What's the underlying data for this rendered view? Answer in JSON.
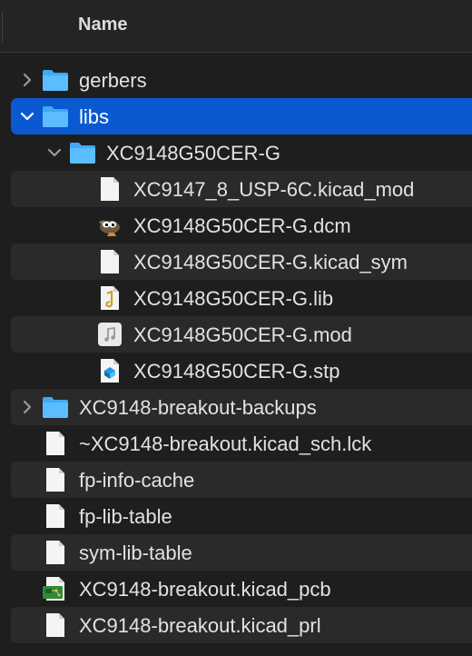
{
  "header": {
    "name_label": "Name"
  },
  "rows": [
    {
      "name": "gerbers",
      "kind": "folder",
      "chevron": "right",
      "alt": false,
      "selected": false
    },
    {
      "name": "libs",
      "kind": "folder",
      "chevron": "down",
      "alt": false,
      "selected": true
    },
    {
      "name": "XC9148G50CER-G",
      "kind": "folder",
      "chevron": "down",
      "alt": false,
      "selected": false
    },
    {
      "name": "XC9147_8_USP-6C.kicad_mod",
      "kind": "file-blank",
      "alt": true,
      "selected": false
    },
    {
      "name": "XC9148G50CER-G.dcm",
      "kind": "file-gimp",
      "alt": false,
      "selected": false
    },
    {
      "name": "XC9148G50CER-G.kicad_sym",
      "kind": "file-blank",
      "alt": true,
      "selected": false
    },
    {
      "name": "XC9148G50CER-G.lib",
      "kind": "file-lib",
      "alt": false,
      "selected": false
    },
    {
      "name": "XC9148G50CER-G.mod",
      "kind": "file-audio",
      "alt": true,
      "selected": false
    },
    {
      "name": "XC9148G50CER-G.stp",
      "kind": "file-stp",
      "alt": false,
      "selected": false
    },
    {
      "name": "XC9148-breakout-backups",
      "kind": "folder",
      "chevron": "right",
      "alt": true,
      "selected": false
    },
    {
      "name": "~XC9148-breakout.kicad_sch.lck",
      "kind": "file-blank",
      "alt": false,
      "selected": false
    },
    {
      "name": "fp-info-cache",
      "kind": "file-blank",
      "alt": true,
      "selected": false
    },
    {
      "name": "fp-lib-table",
      "kind": "file-blank",
      "alt": false,
      "selected": false
    },
    {
      "name": "sym-lib-table",
      "kind": "file-blank",
      "alt": true,
      "selected": false
    },
    {
      "name": "XC9148-breakout.kicad_pcb",
      "kind": "file-pcb",
      "alt": false,
      "selected": false
    },
    {
      "name": "XC9148-breakout.kicad_prl",
      "kind": "file-blank",
      "alt": true,
      "selected": false
    }
  ],
  "colors": {
    "background": "#1e1e1e",
    "selection": "#0a59d1",
    "stripe": "#2a2a2a",
    "folder": "#3fa9f5",
    "text": "#e2e2e2"
  }
}
